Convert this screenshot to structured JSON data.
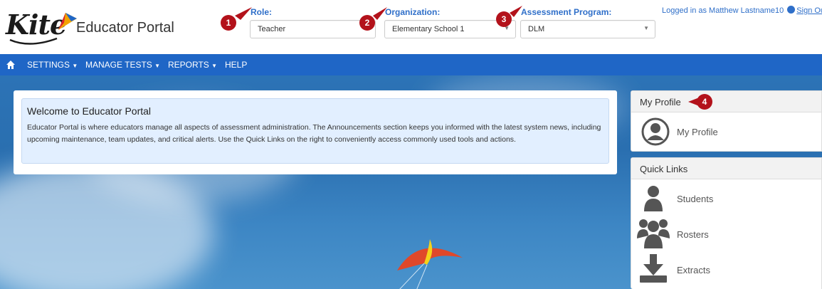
{
  "header": {
    "logo_text": "Kite",
    "portal_title": "Educator Portal",
    "role": {
      "label": "Role:",
      "value": "Teacher"
    },
    "organization": {
      "label": "Organization:",
      "value": "Elementary School 1"
    },
    "program": {
      "label": "Assessment Program:",
      "value": "DLM"
    },
    "login_text": "Logged in as Matthew Lastname10",
    "sign_out": "Sign Ou"
  },
  "badges": [
    "1",
    "2",
    "3",
    "4"
  ],
  "nav": {
    "items": [
      "SETTINGS",
      "MANAGE TESTS",
      "REPORTS",
      "HELP"
    ]
  },
  "welcome": {
    "title": "Welcome to Educator Portal",
    "body": "Educator Portal is where educators manage all aspects of assessment administration. The Announcements section keeps you informed with the latest system news, including upcoming maintenance, team updates, and critical alerts. Use the Quick Links on the right to conveniently access commonly used tools and actions."
  },
  "profile": {
    "heading": "My Profile",
    "link": "My Profile"
  },
  "quick_links": {
    "heading": "Quick Links",
    "items": [
      "Students",
      "Rosters",
      "Extracts"
    ]
  },
  "colors": {
    "accent": "#2f6fc9",
    "nav": "#1f66c6",
    "badge": "#b3121b"
  }
}
